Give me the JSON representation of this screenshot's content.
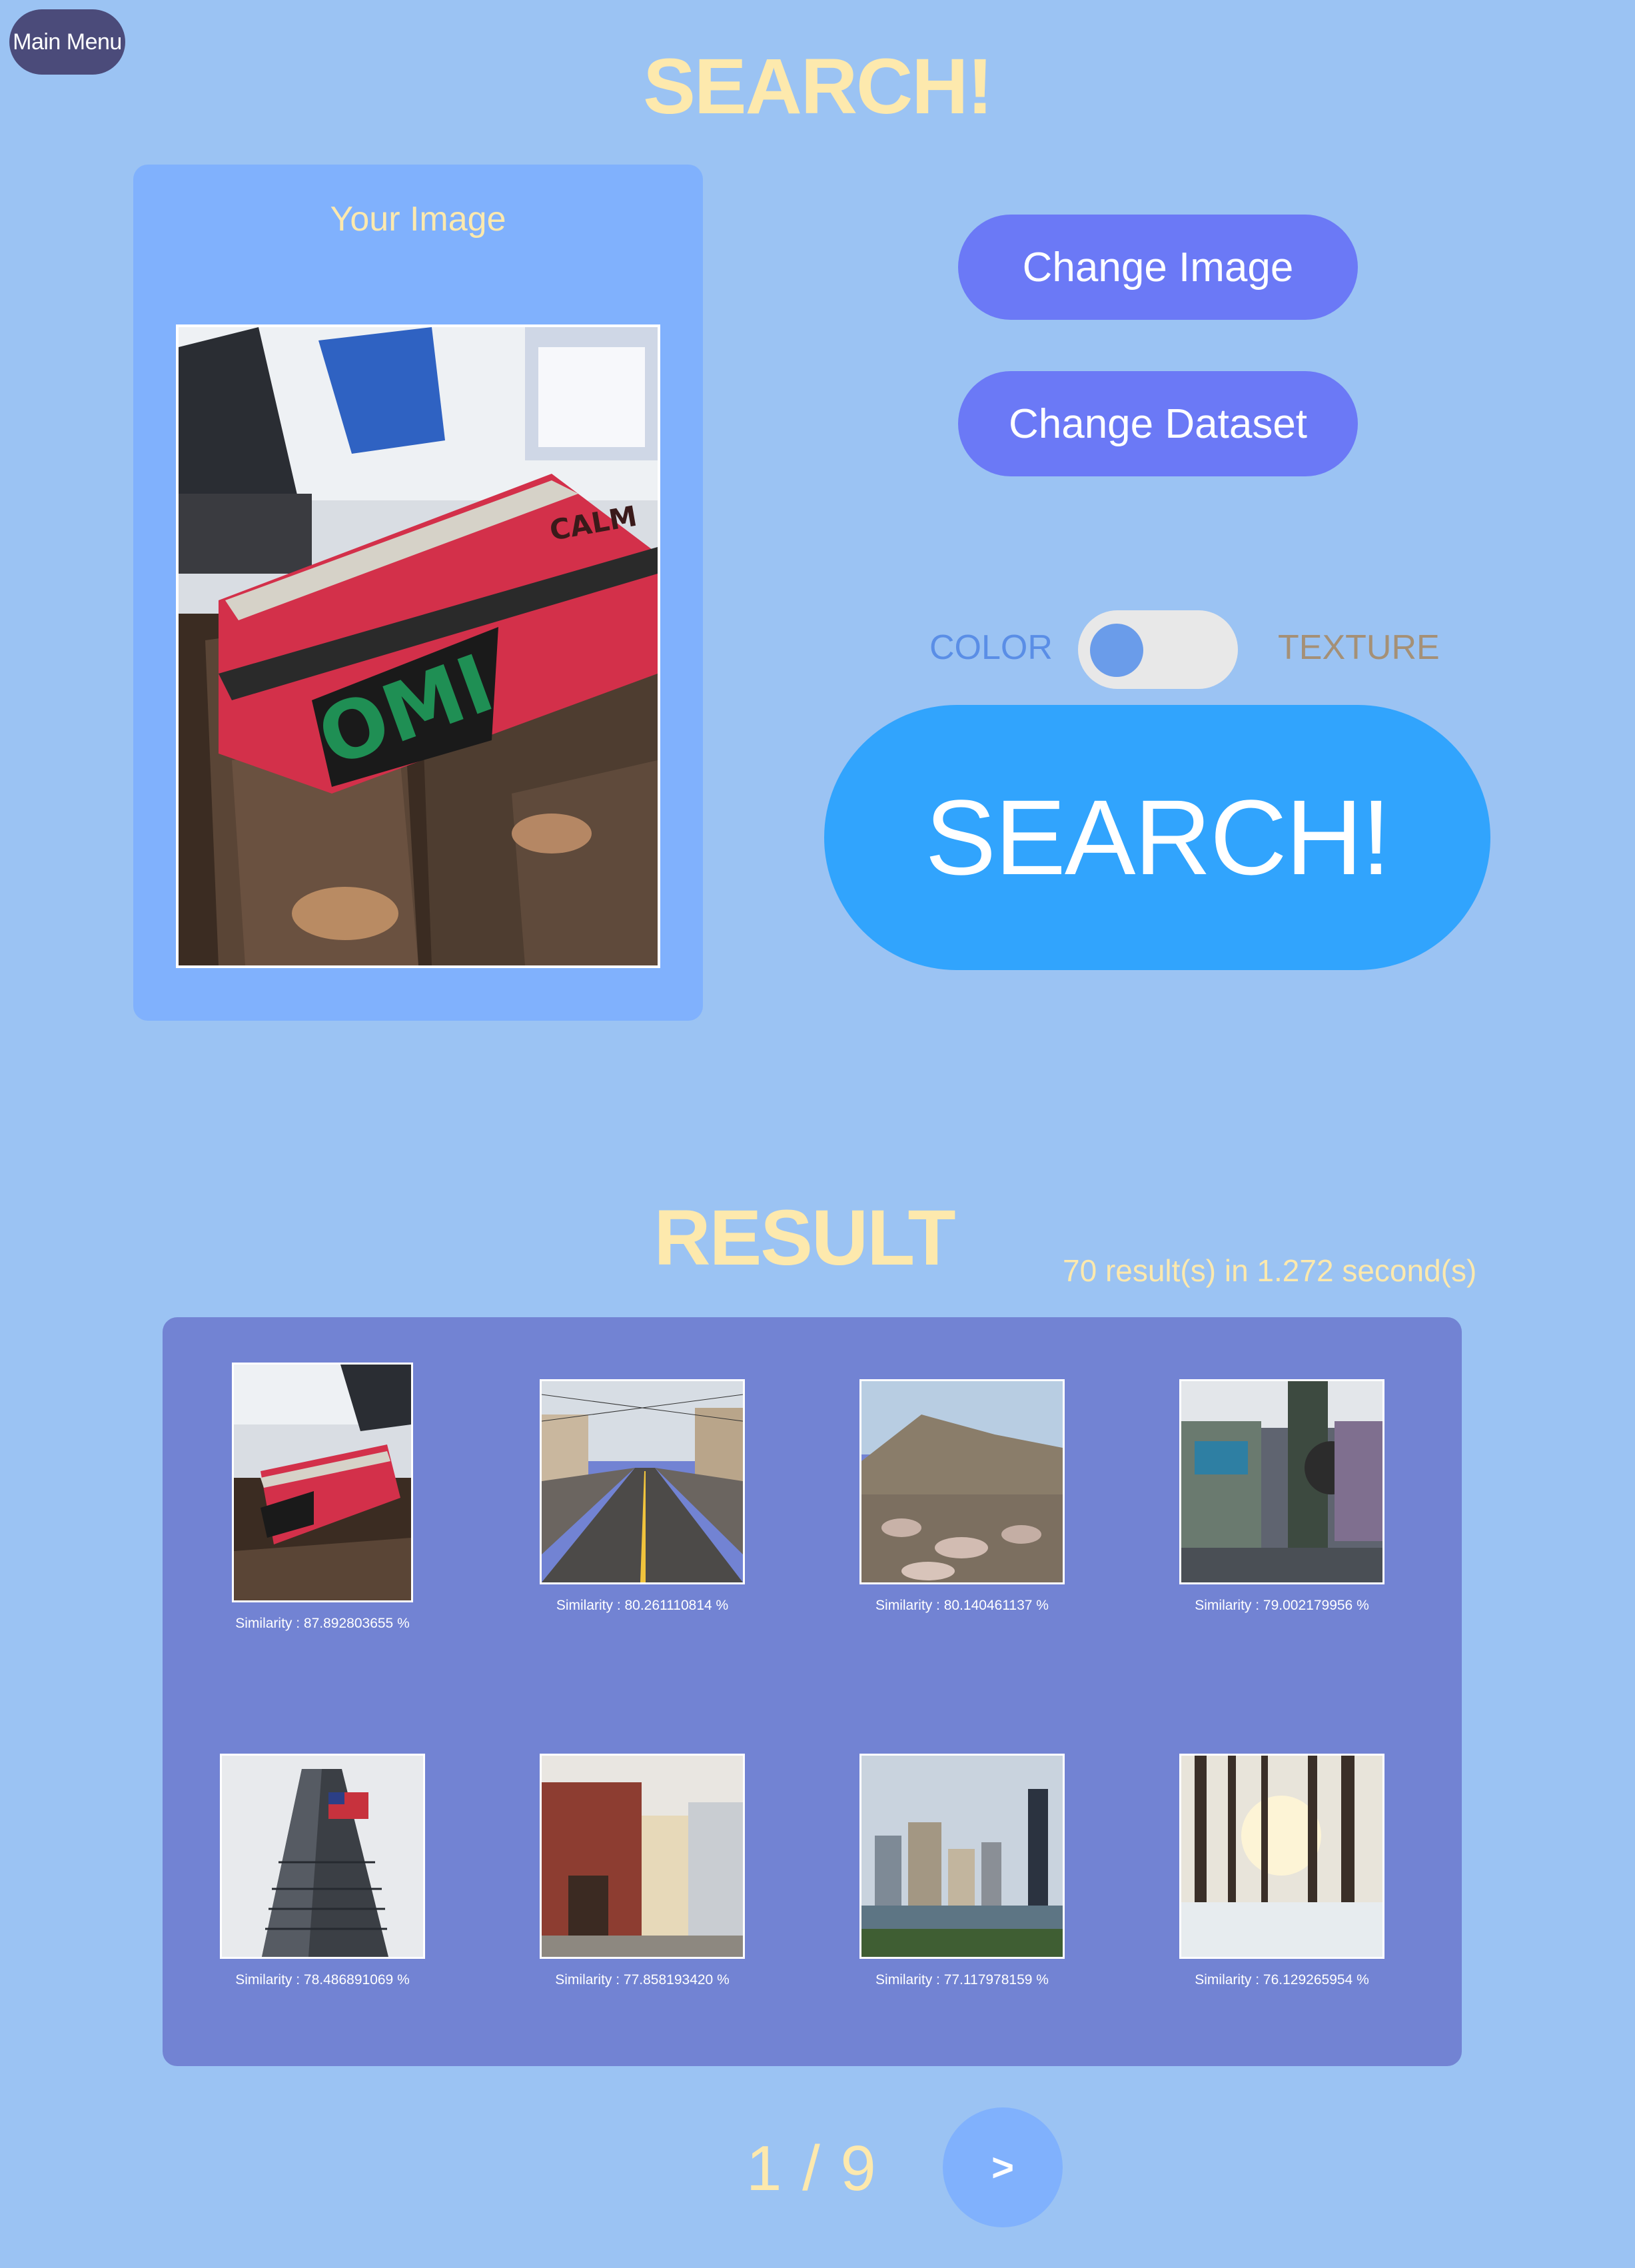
{
  "nav": {
    "main_menu_label": "Main Menu"
  },
  "header": {
    "title": "SEARCH!"
  },
  "query_panel": {
    "title": "Your Image"
  },
  "actions": {
    "change_image_label": "Change Image",
    "change_dataset_label": "Change Dataset",
    "search_label": "SEARCH!"
  },
  "mode_toggle": {
    "left_label": "COLOR",
    "right_label": "TEXTURE",
    "selected": "COLOR"
  },
  "results": {
    "title": "RESULT",
    "summary": "70 result(s) in 1.272 second(s)",
    "items": [
      {
        "similarity": "Similarity : 87.892803655 %",
        "subject": "red pencil case on bench"
      },
      {
        "similarity": "Similarity : 80.261110814 %",
        "subject": "street with tram tracks"
      },
      {
        "similarity": "Similarity : 80.140461137 %",
        "subject": "rocky mountain field"
      },
      {
        "similarity": "Similarity : 79.002179956 %",
        "subject": "graffiti wall and pole"
      },
      {
        "similarity": "Similarity : 78.486891069 %",
        "subject": "skyscraper with flag"
      },
      {
        "similarity": "Similarity : 77.858193420 %",
        "subject": "brick town buildings"
      },
      {
        "similarity": "Similarity : 77.117978159 %",
        "subject": "city skyline over river"
      },
      {
        "similarity": "Similarity : 76.129265954 %",
        "subject": "snowy forest with sun"
      }
    ]
  },
  "pagination": {
    "label": "1 / 9",
    "next_label": ">"
  },
  "colors": {
    "background": "#9bc3f3",
    "accent_text": "#fde9ad",
    "button": "#6b79f6",
    "search_button": "#31a4fd",
    "results_panel": "#7283d3"
  }
}
